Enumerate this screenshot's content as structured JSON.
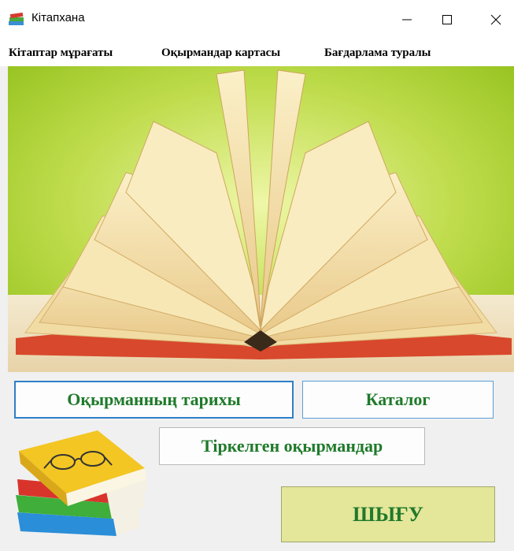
{
  "window": {
    "title": "Кітапхана"
  },
  "menu": {
    "items": [
      "Кітаптар мұрағаты",
      "Оқырмандар картасы",
      "Бағдарлама туралы"
    ]
  },
  "buttons": {
    "history": "Оқырманның тарихы",
    "catalog": "Каталог",
    "registered": "Тіркелген оқырмандар",
    "exit": "ШЫҒУ"
  },
  "colors": {
    "button_text": "#1f7a2a",
    "exit_bg": "#e4e69a",
    "banner_bg": "#b2d640"
  },
  "icons": {
    "app": "books-app-icon",
    "minimize": "minimize-icon",
    "maximize": "maximize-icon",
    "close": "close-icon"
  }
}
